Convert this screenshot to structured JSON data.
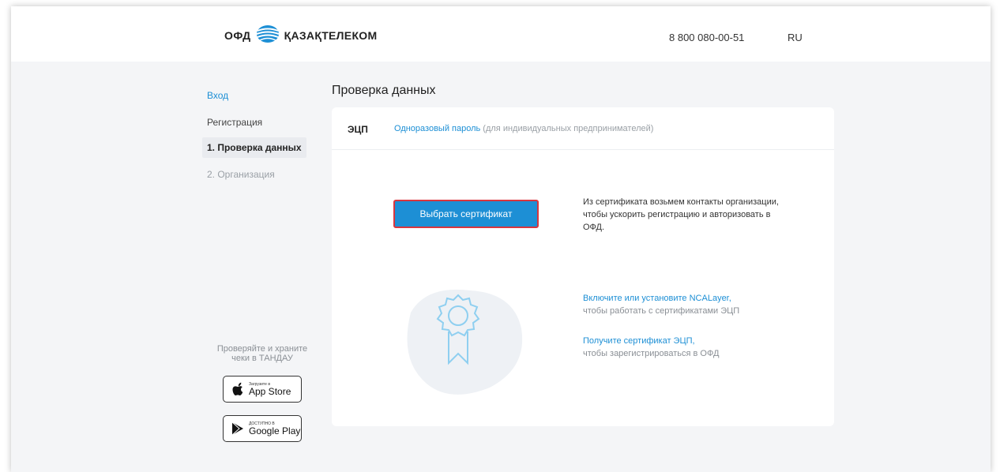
{
  "header": {
    "logo_ofd": "ОФД",
    "logo_company": "ҚАЗАҚТЕЛЕКОМ",
    "phone": "8 800 080-00-51",
    "lang": "RU"
  },
  "sidebar": {
    "items": [
      {
        "label": "Вход"
      },
      {
        "label": "Регистрация"
      },
      {
        "label": "1. Проверка данных"
      },
      {
        "label": "2. Организация"
      }
    ],
    "promo_line1": "Проверяйте и храните",
    "promo_line2": "чеки в ТАНДАУ",
    "appstore_small": "Загрузите в",
    "appstore_big": "App Store",
    "googleplay_small": "ДОСТУПНО В",
    "googleplay_big": "Google Play"
  },
  "main": {
    "title": "Проверка данных",
    "tabs": {
      "ecp": "ЭЦП",
      "otp": "Одноразовый пароль",
      "otp_note": " (для индивидуальных предпринимателей)"
    },
    "select_button": "Выбрать сертификат",
    "info_text": "Из сертификата возьмем контакты организации, чтобы ускорить регистрацию и авторизовать в ОФД.",
    "ncalayer_link": "Включите или установите NCALayer,",
    "ncalayer_note": "чтобы работать с сертификатами ЭЦП",
    "getcert_link": "Получите сертификат ЭЦП,",
    "getcert_note": "чтобы зарегистрироваться в ОФД"
  },
  "colors": {
    "accent": "#1d8fd5",
    "highlight_border": "#d9363e",
    "background": "#f4f5f7"
  }
}
